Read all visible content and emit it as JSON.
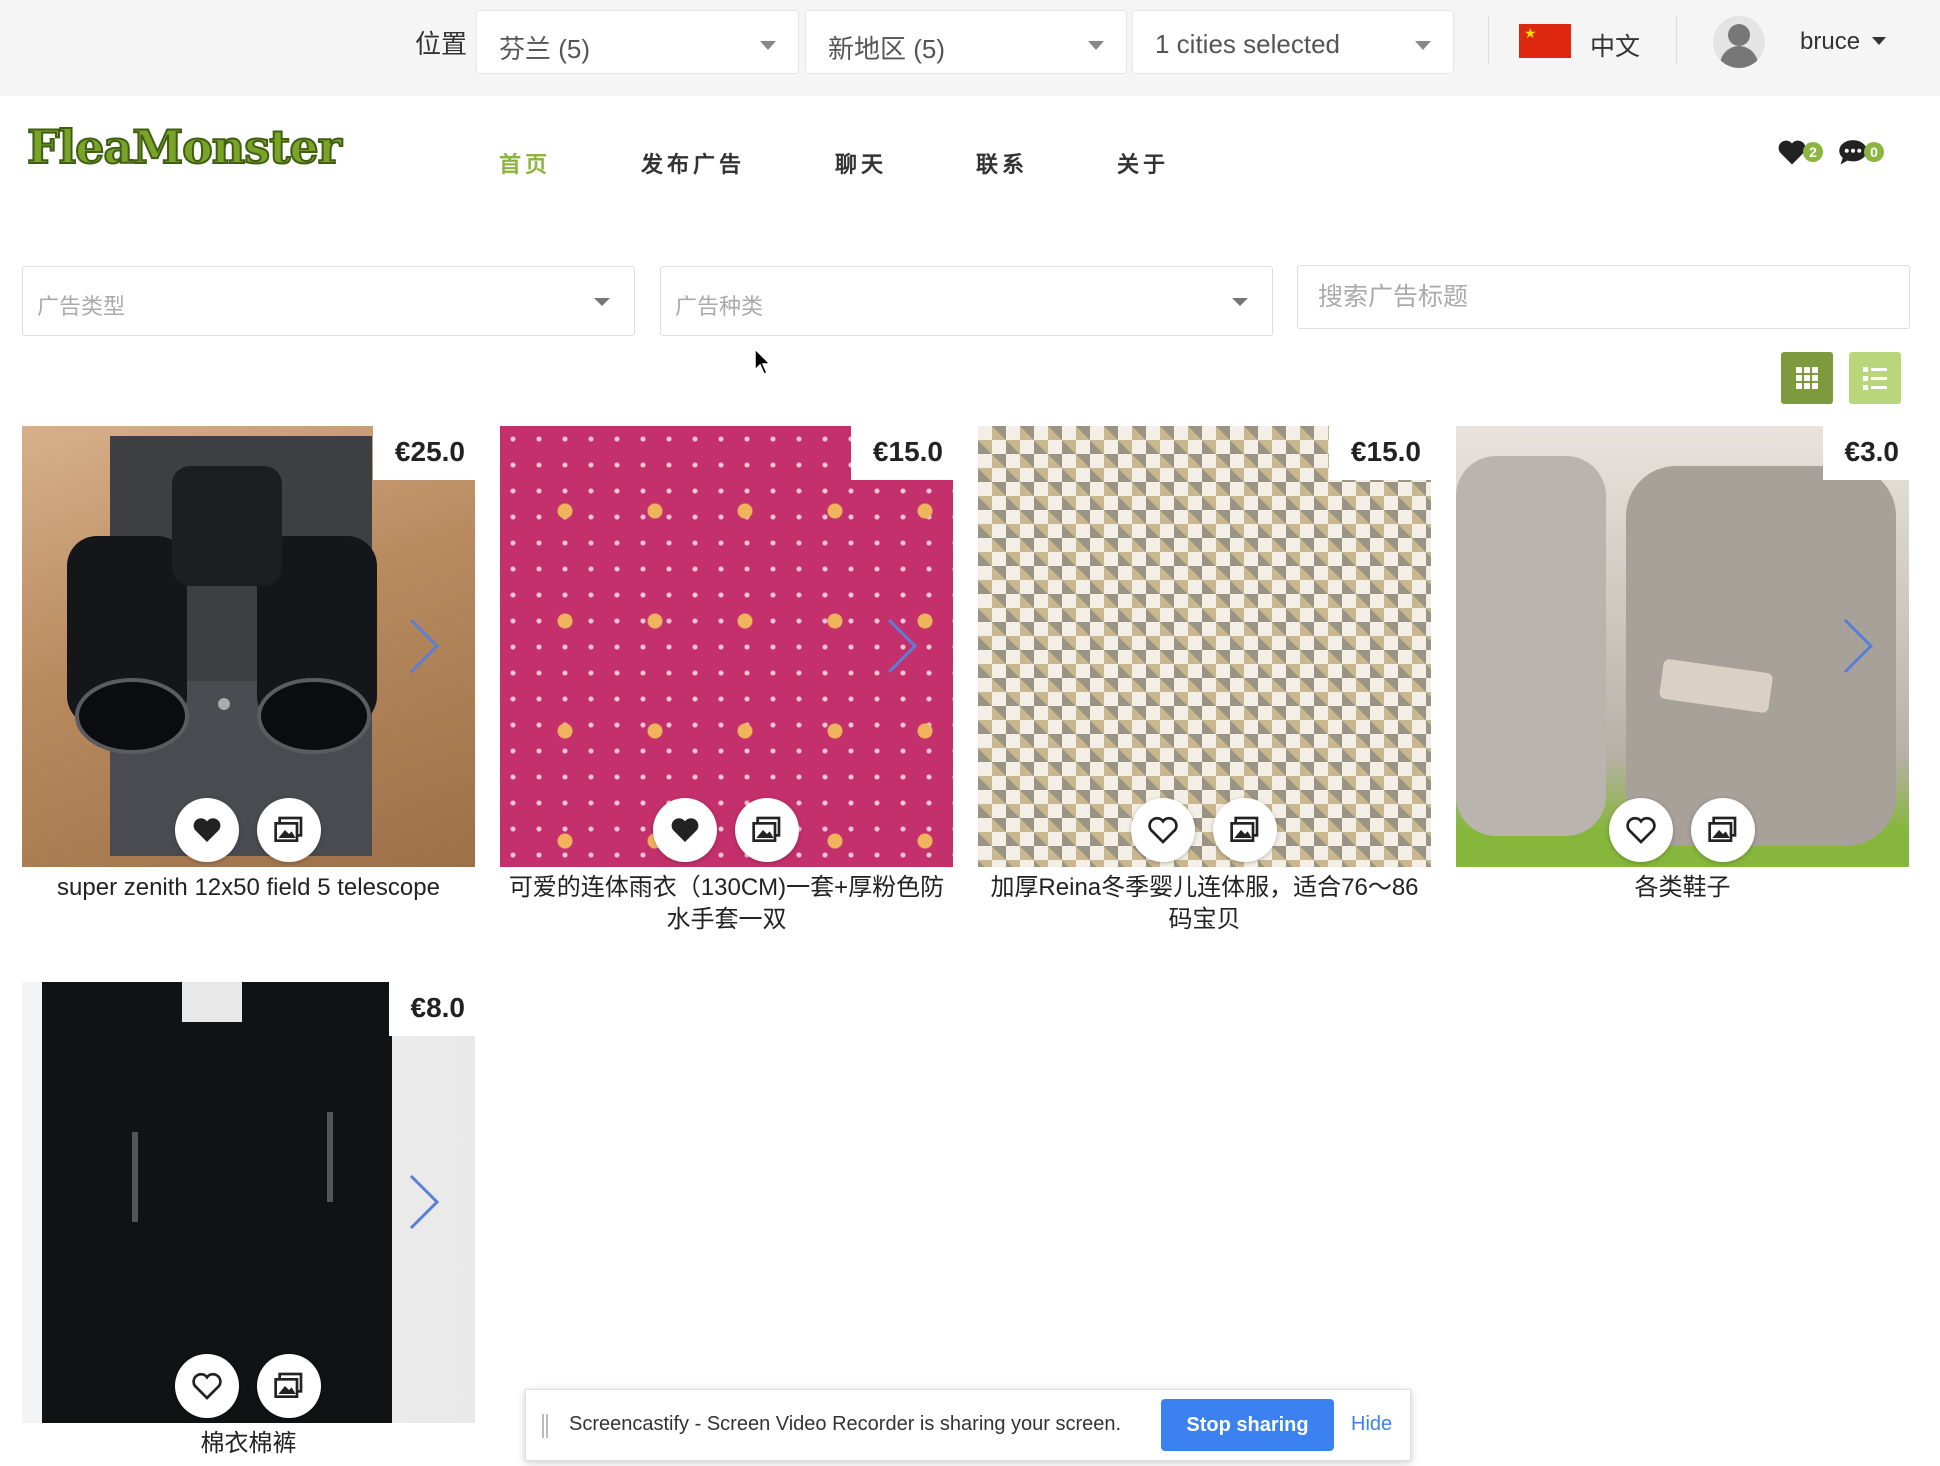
{
  "topbar": {
    "location_label": "位置",
    "country_select": "芬兰 (5)",
    "region_select": "新地区 (5)",
    "city_select": "1 cities selected",
    "language": "中文",
    "username": "bruce",
    "flag_color": "#de2910"
  },
  "nav": {
    "logo": "FleaMonster",
    "items": [
      {
        "label": "首页",
        "active": true
      },
      {
        "label": "发布广告",
        "active": false
      },
      {
        "label": "聊天",
        "active": false
      },
      {
        "label": "联系",
        "active": false
      },
      {
        "label": "关于",
        "active": false
      }
    ],
    "favorites_count": "2",
    "messages_count": "0",
    "accent_color": "#8cb43f"
  },
  "filters": {
    "ad_type_placeholder": "广告类型",
    "ad_category_placeholder": "广告种类",
    "search_placeholder": "搜索广告标题"
  },
  "listings": [
    {
      "price": "€25.0",
      "title": "super zenith 12x50 field 5 telescope",
      "favorited": true
    },
    {
      "price": "€15.0",
      "title": "可爱的连体雨衣（130CM)一套+厚粉色防水手套一双",
      "favorited": true
    },
    {
      "price": "€15.0",
      "title": "加厚Reina冬季婴儿连体服，适合76～86码宝贝",
      "favorited": false
    },
    {
      "price": "€3.0",
      "title": "各类鞋子",
      "favorited": false
    },
    {
      "price": "€8.0",
      "title": "棉衣棉裤",
      "favorited": false
    }
  ],
  "share_bar": {
    "message": "Screencastify - Screen Video Recorder is sharing your screen.",
    "stop_label": "Stop sharing",
    "hide_label": "Hide"
  }
}
